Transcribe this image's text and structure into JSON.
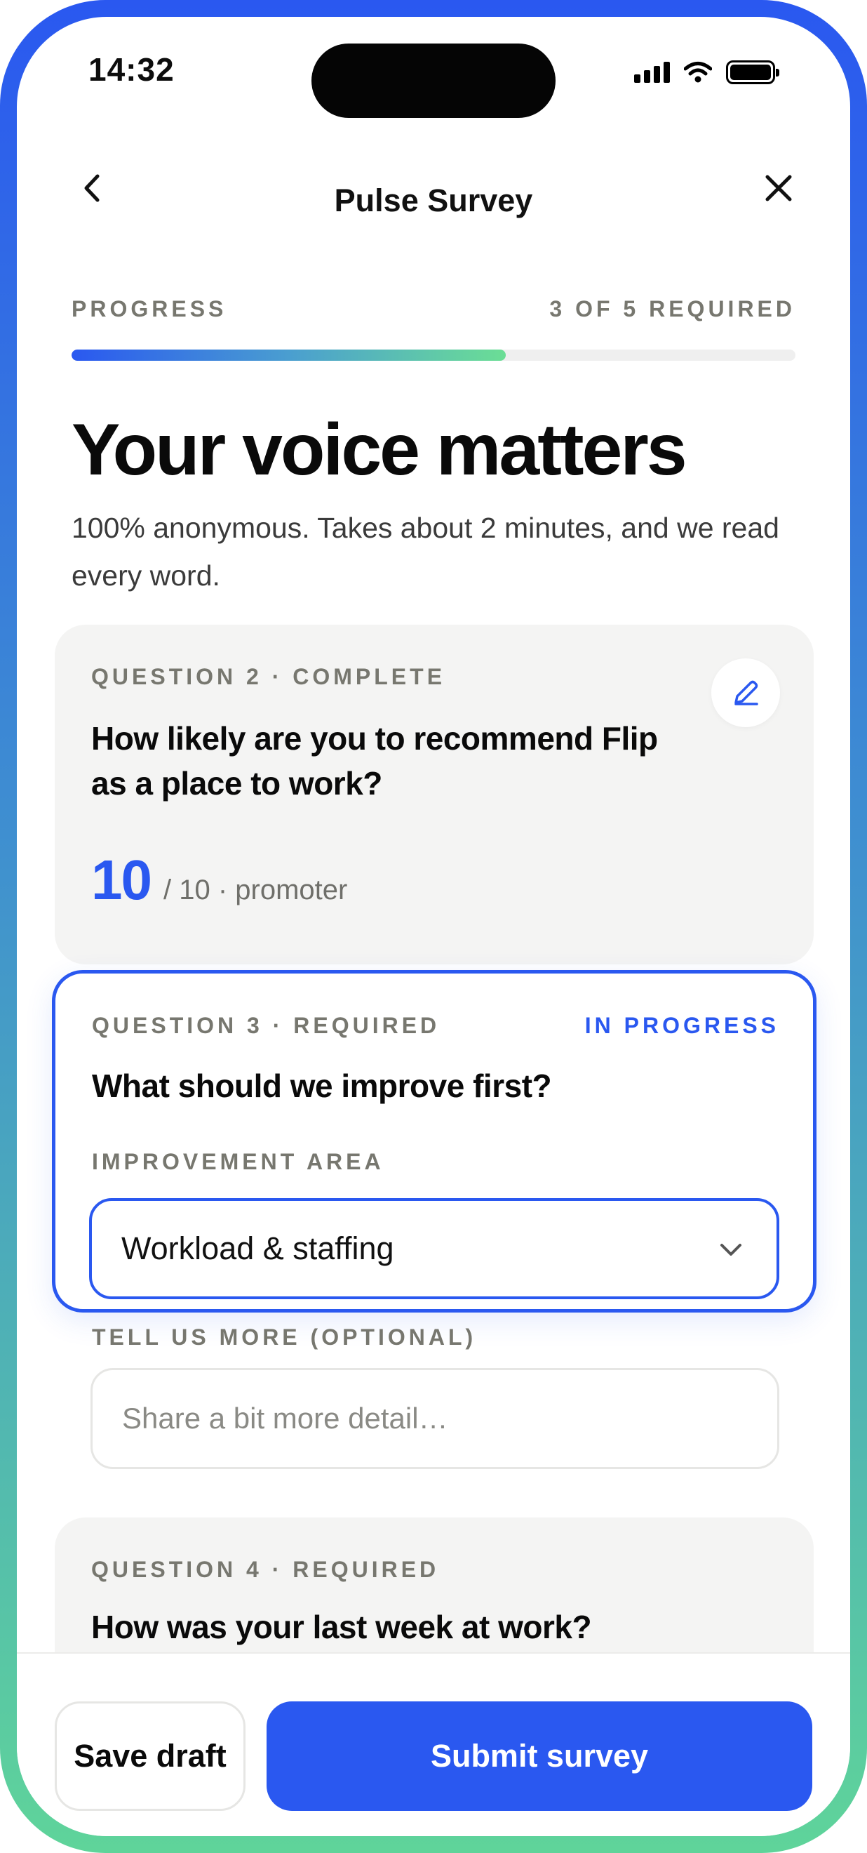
{
  "status_bar": {
    "time": "14:32"
  },
  "nav": {
    "title": "Pulse Survey"
  },
  "progress": {
    "label": "PROGRESS",
    "count_text": "3 OF 5 REQUIRED",
    "fraction": 0.6
  },
  "hero": {
    "headline": "Your voice matters",
    "subtitle": "100% anonymous. Takes about 2 minutes, and we read every word."
  },
  "questions": [
    {
      "label": "QUESTION 2 · COMPLETE",
      "text": "How likely are you to recommend Flip as a place to work?",
      "score": "10",
      "score_meta": "/ 10 · promoter"
    },
    {
      "label": "QUESTION 3 · REQUIRED",
      "status": "IN PROGRESS",
      "text": "What should we improve first?",
      "area_label": "IMPROVEMENT AREA",
      "area_value": "Workload & staffing",
      "more_label": "TELL US MORE (OPTIONAL)",
      "more_placeholder": "Share a bit more detail…"
    },
    {
      "label": "QUESTION 4 · REQUIRED",
      "text": "How was your last week at work?"
    }
  ],
  "actions": {
    "save_draft": "Save draft",
    "submit": "Submit survey"
  },
  "colors": {
    "accent": "#2a58f0",
    "accent_green": "#6bde95",
    "card_bg": "#f4f4f3"
  }
}
